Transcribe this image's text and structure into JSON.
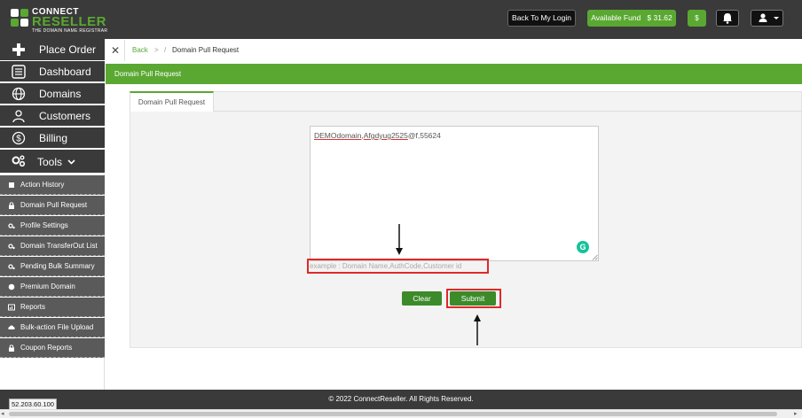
{
  "brand": {
    "line1": "CONNECT",
    "line2": "RESELLER",
    "tagline": "THE DOMAIN NAME REGISTRAR",
    "accent": "#5aa832"
  },
  "header": {
    "back_to_login": "Back To My Login",
    "fund_label": "Available Fund",
    "fund_amount": "$ 31.62",
    "dollar_button": "$"
  },
  "sidebar": {
    "main_items": [
      {
        "label": "Place Order",
        "icon": "plus-icon"
      },
      {
        "label": "Dashboard",
        "icon": "dashboard-icon"
      },
      {
        "label": "Domains",
        "icon": "globe-icon"
      },
      {
        "label": "Customers",
        "icon": "users-icon"
      },
      {
        "label": "Billing",
        "icon": "dollar-circle-icon"
      },
      {
        "label": "Tools",
        "icon": "gears-icon"
      }
    ],
    "sub_items": [
      {
        "label": "Action History",
        "icon": "history-icon"
      },
      {
        "label": "Domain Pull Request",
        "icon": "lock-icon"
      },
      {
        "label": "Profile Settings",
        "icon": "gears-icon"
      },
      {
        "label": "Domain TransferOut List",
        "icon": "gears-icon"
      },
      {
        "label": "Pending Bulk Summary",
        "icon": "gears-icon"
      },
      {
        "label": "Premium Domain",
        "icon": "circle-icon"
      },
      {
        "label": "Reports",
        "icon": "report-icon"
      },
      {
        "label": "Bulk-action File Upload",
        "icon": "upload-icon"
      },
      {
        "label": "Coupon Reports",
        "icon": "lock-icon"
      }
    ]
  },
  "breadcrumb": {
    "back": "Back",
    "sep": ">",
    "sep2": "/",
    "current": "Domain Pull Request"
  },
  "page": {
    "header_title": "Domain Pull Request",
    "tab_label": "Domain Pull Request",
    "textarea_part1": "DEMOdomain",
    "textarea_part2": ",",
    "textarea_part3": "Afgdyug2525",
    "textarea_part4": "@f,55624",
    "hint": "example : Domain Name,AuthCode,Customer id",
    "clear_label": "Clear",
    "submit_label": "Submit",
    "grammarly_glyph": "G"
  },
  "footer": {
    "copyright": "© 2022 ConnectReseller. All Rights Reserved.",
    "ip": "52.203.60.100"
  }
}
